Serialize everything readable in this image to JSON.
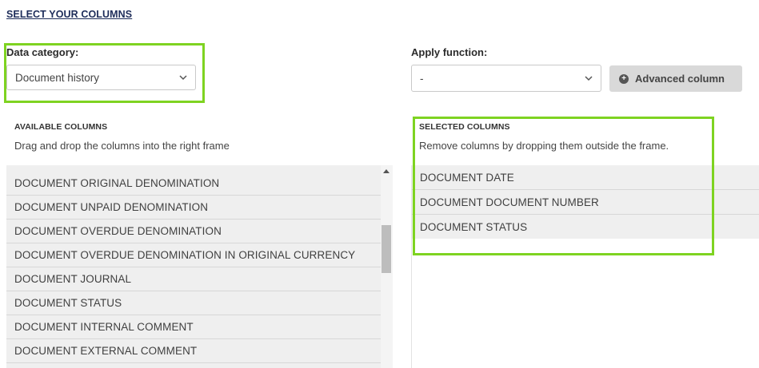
{
  "header": {
    "title": "SELECT YOUR COLUMNS"
  },
  "data_category": {
    "label": "Data category:",
    "selected": "Document history"
  },
  "apply_function": {
    "label": "Apply function:",
    "selected": "-"
  },
  "advanced_button": {
    "label": "Advanced column",
    "icon": "plus-circle-icon"
  },
  "available": {
    "heading": "AVAILABLE COLUMNS",
    "help": "Drag and drop the columns into the right frame",
    "items": [
      "DOCUMENT ORIGINAL DENOMINATION",
      "DOCUMENT UNPAID DENOMINATION",
      "DOCUMENT OVERDUE DENOMINATION",
      "DOCUMENT OVERDUE DENOMINATION IN ORIGINAL CURRENCY",
      "DOCUMENT JOURNAL",
      "DOCUMENT STATUS",
      "DOCUMENT INTERNAL COMMENT",
      "DOCUMENT EXTERNAL COMMENT"
    ]
  },
  "selected": {
    "heading": "SELECTED COLUMNS",
    "help": "Remove columns by dropping them outside the frame.",
    "items": [
      "DOCUMENT DATE",
      "DOCUMENT DOCUMENT NUMBER",
      "DOCUMENT STATUS"
    ]
  },
  "colors": {
    "highlight": "#7ed321",
    "title": "#1e2d5a",
    "panel": "#efefef"
  }
}
